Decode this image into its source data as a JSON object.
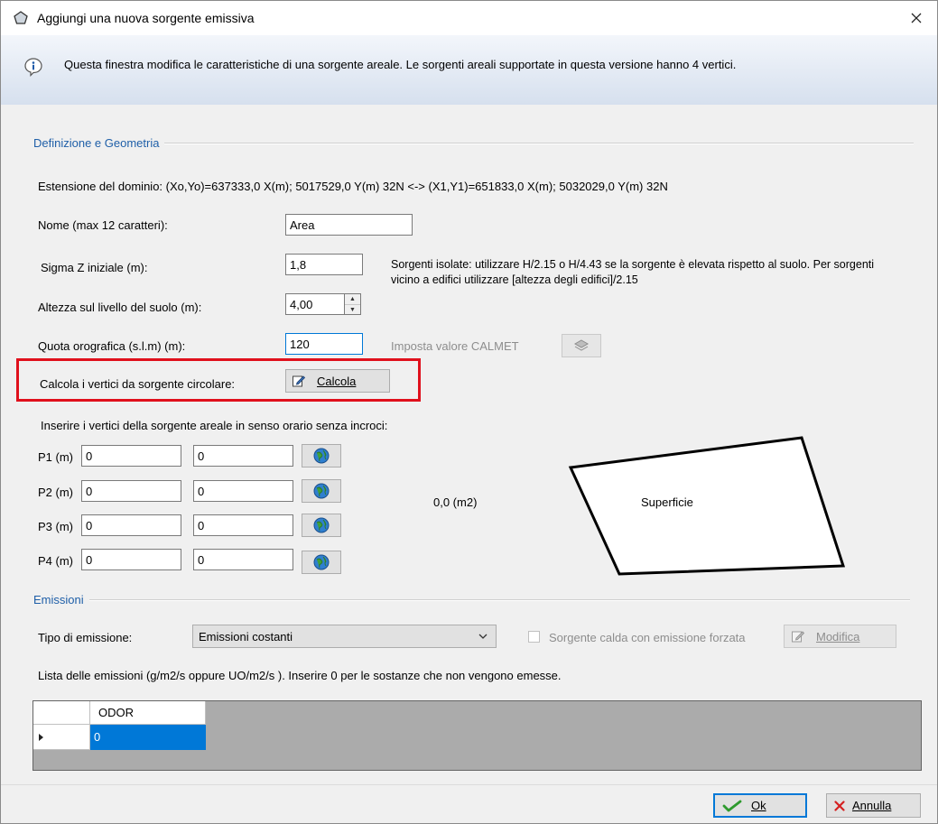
{
  "window": {
    "title": "Aggiungi una nuova sorgente emissiva",
    "info_text": "Questa finestra modifica le caratteristiche di una sorgente areale. Le sorgenti areali supportate in questa versione hanno 4 vertici."
  },
  "geometry": {
    "section_title": "Definizione e Geometria",
    "domain_extent": "Estensione del dominio: (Xo,Yo)=637333,0 X(m); 5017529,0 Y(m) 32N  <-> (X1,Y1)=651833,0 X(m); 5032029,0 Y(m) 32N",
    "name_label": "Nome (max 12 caratteri):",
    "name_value": "Area",
    "sigma_label": "Sigma Z iniziale (m):",
    "sigma_value": "1,8",
    "sigma_hint_line1": "Sorgenti isolate: utilizzare H/2.15 o H/4.43 se la sorgente è elevata rispetto al suolo. Per sorgenti",
    "sigma_hint_line2": "vicino a edifici utilizzare [altezza degli edifici]/2.15",
    "height_label": "Altezza sul livello del suolo (m):",
    "height_value": "4,00",
    "quota_label": "Quota orografica (s.l.m)  (m):",
    "quota_value": "120",
    "calmet_label": "Imposta valore CALMET",
    "circle_label": "Calcola i vertici da sorgente circolare:",
    "calcola_button": "Calcola",
    "vertices_instruction": "Inserire i vertici della sorgente areale in senso orario senza incroci:",
    "vertices": [
      {
        "label": "P1 (m)",
        "x": "0",
        "y": "0"
      },
      {
        "label": "P2 (m)",
        "x": "0",
        "y": "0"
      },
      {
        "label": "P3 (m)",
        "x": "0",
        "y": "0"
      },
      {
        "label": "P4 (m)",
        "x": "0",
        "y": "0"
      }
    ],
    "area_value": "0,0 (m2)",
    "surface_label": "Superficie"
  },
  "emissions": {
    "section_title": "Emissioni",
    "type_label": "Tipo di emissione:",
    "type_value": "Emissioni costanti",
    "hot_source_label": "Sorgente calda con emissione forzata",
    "modify_button": "Modifica",
    "list_label": "Lista delle emissioni (g/m2/s oppure UO/m2/s ). Inserire 0 per le sostanze che non vengono emesse.",
    "grid_header": "ODOR",
    "grid_value": "0"
  },
  "footer": {
    "ok_button": "Ok",
    "cancel_button": "Annulla"
  },
  "colors": {
    "accent": "#0078d7",
    "section_title": "#1f5fa8",
    "highlight_box": "#e0101c"
  }
}
